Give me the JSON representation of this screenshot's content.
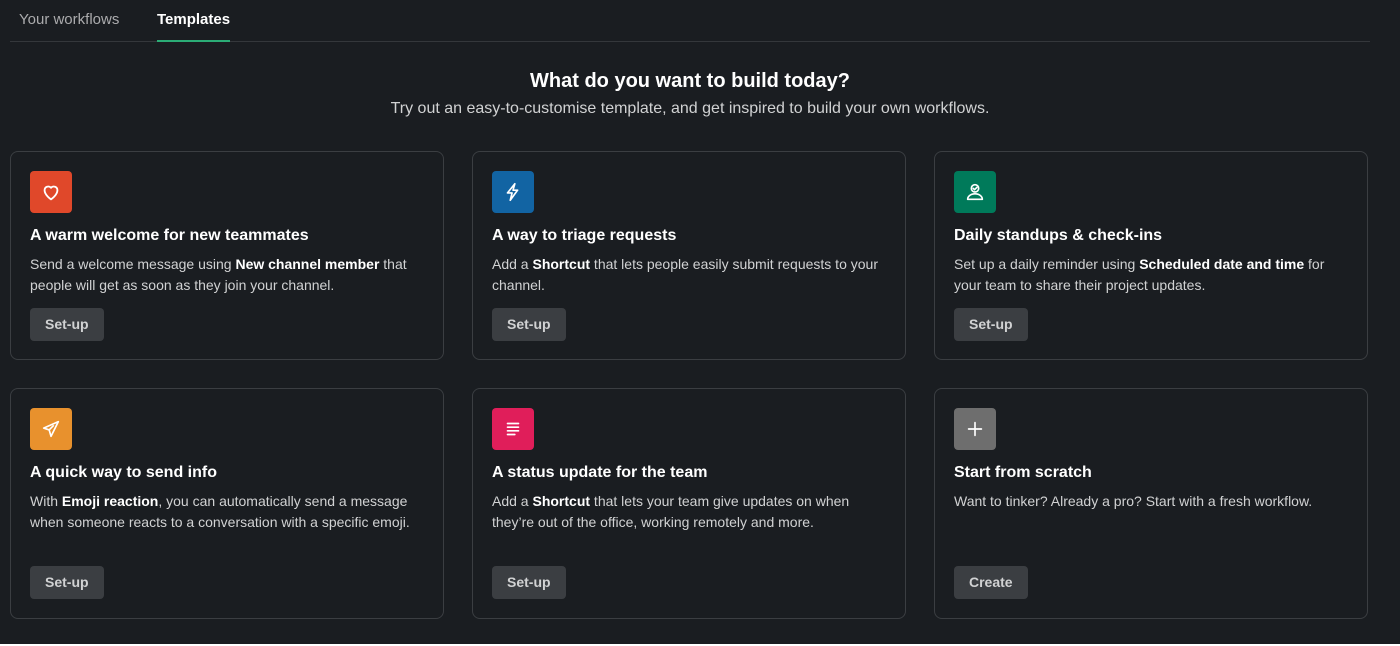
{
  "tabs": [
    {
      "label": "Your workflows",
      "active": false
    },
    {
      "label": "Templates",
      "active": true
    }
  ],
  "hero": {
    "title": "What do you want to build today?",
    "subtitle": "Try out an easy-to-customise template, and get inspired to build your own workflows."
  },
  "colors": {
    "background": "#1a1d21",
    "tab_underline": "#2bac76",
    "button_bg": "#3b3e42"
  },
  "templates": [
    {
      "icon": "heart-icon",
      "icon_color": "#e0482a",
      "title": "A warm welcome for new teammates",
      "desc_pre": "Send a welcome message using ",
      "desc_bold": "New channel member",
      "desc_post": " that people will get as soon as they join your channel.",
      "button": "Set-up"
    },
    {
      "icon": "lightning-icon",
      "icon_color": "#1264a3",
      "title": "A way to triage requests",
      "desc_pre": "Add a ",
      "desc_bold": "Shortcut",
      "desc_post": " that lets people easily submit requests to your channel.",
      "button": "Set-up"
    },
    {
      "icon": "person-check-icon",
      "icon_color": "#007a5a",
      "title": "Daily standups & check-ins",
      "desc_pre": "Set up a daily reminder using ",
      "desc_bold": "Scheduled date and time",
      "desc_post": " for your team to share their project updates.",
      "button": "Set-up"
    },
    {
      "icon": "paper-plane-icon",
      "icon_color": "#e8912d",
      "title": "A quick way to send info",
      "desc_pre": "With ",
      "desc_bold": "Emoji reaction",
      "desc_post": ", you can automatically send a message when someone reacts to a conversation with a specific emoji.",
      "button": "Set-up"
    },
    {
      "icon": "document-lines-icon",
      "icon_color": "#e01e5a",
      "title": "A status update for the team",
      "desc_pre": "Add a ",
      "desc_bold": "Shortcut",
      "desc_post": " that lets your team give updates on when they’re out of the office, working remotely and more.",
      "button": "Set-up"
    },
    {
      "icon": "plus-icon",
      "icon_color": "#6e6e6e",
      "title": "Start from scratch",
      "desc_pre": "Want to tinker? Already a pro? Start with a fresh workflow.",
      "desc_bold": "",
      "desc_post": "",
      "button": "Create"
    }
  ]
}
